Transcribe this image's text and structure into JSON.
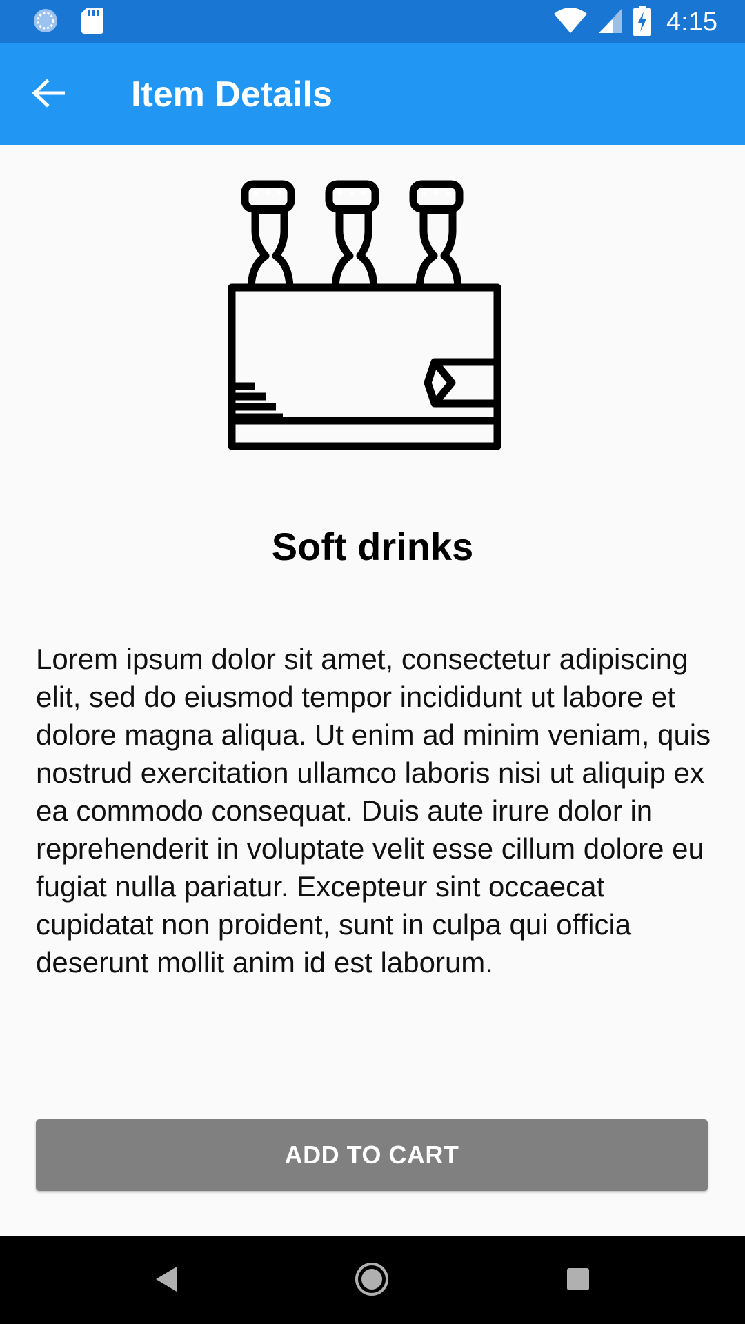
{
  "status_bar": {
    "time": "4:15",
    "icons": [
      "loading-spinner-icon",
      "sd-card-icon",
      "wifi-icon",
      "cellular-signal-icon",
      "battery-charging-icon"
    ]
  },
  "app_bar": {
    "title": "Item Details",
    "back_icon": "arrow-back-icon",
    "color": "#2196f3"
  },
  "item": {
    "image_icon": "bottle-crate-icon",
    "title": "Soft drinks",
    "description": "Lorem ipsum dolor sit amet, consectetur adipiscing elit, sed do eiusmod tempor incididunt ut labore et dolore magna aliqua. Ut enim ad minim veniam, quis nostrud exercitation ullamco laboris nisi ut aliquip ex ea commodo consequat. Duis aute irure dolor in reprehenderit in voluptate velit esse cillum dolore eu fugiat nulla pariatur. Excepteur sint occaecat cupidatat non proident, sunt in culpa qui officia deserunt mollit anim id est laborum."
  },
  "actions": {
    "add_to_cart_label": "ADD TO CART",
    "button_color": "#808080"
  },
  "nav_bar": {
    "icons": [
      "back-triangle-icon",
      "home-circle-icon",
      "recents-square-icon"
    ]
  }
}
